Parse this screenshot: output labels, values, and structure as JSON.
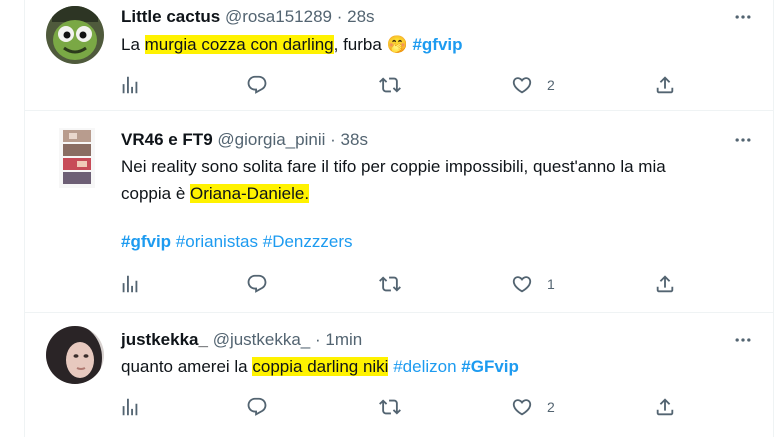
{
  "tweets": [
    {
      "name": "Little cactus",
      "handle": "@rosa151289",
      "sep": "·",
      "time": "28s",
      "text": {
        "p1": "La ",
        "h1": "murgia  cozza con darling",
        "p2": ", furba ",
        "emoji": "🤭",
        "tag1": "#gfvip"
      },
      "likes": "2"
    },
    {
      "name": "VR46 e FT9",
      "handle": "@giorgia_pinii",
      "sep": "·",
      "time": "38s",
      "text": {
        "p1": "Nei reality sono solita fare il tifo per coppie impossibili, quest'anno la mia",
        "p2": "coppia è ",
        "h1": "Oriana-Daniele.",
        "tag1": "#gfvip",
        "tag2": "#orianistas",
        "tag3": "#Denzzzers"
      },
      "likes": "1"
    },
    {
      "name": "justkekka_",
      "handle": "@justkekka_",
      "sep": "·",
      "time": "1min",
      "text": {
        "p1": "quanto amerei la ",
        "h1": "coppia darling niki",
        "tag1": "#delizon",
        "tag2": "#GFvip"
      },
      "likes": "2"
    }
  ],
  "icons": {
    "more": "more-horizontal-icon",
    "analytics": "analytics-icon",
    "reply": "reply-icon",
    "retweet": "retweet-icon",
    "like": "heart-icon",
    "share": "share-icon"
  },
  "colors": {
    "highlight": "#fff200",
    "hashtag": "#1d9bf0",
    "secondary": "#536471"
  }
}
